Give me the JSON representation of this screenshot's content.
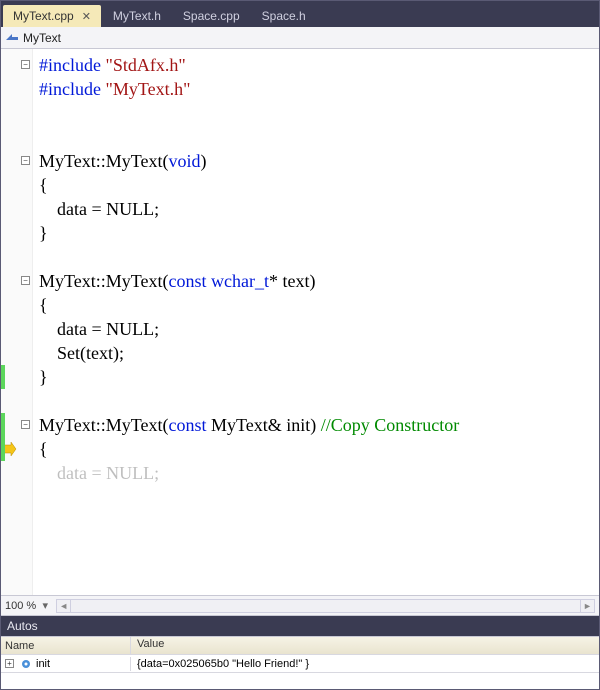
{
  "tabs": [
    {
      "label": "MyText.cpp",
      "active": true
    },
    {
      "label": "MyText.h",
      "active": false
    },
    {
      "label": "Space.cpp",
      "active": false
    },
    {
      "label": "Space.h",
      "active": false
    }
  ],
  "nav": {
    "scope": "MyText"
  },
  "zoom": {
    "level": "100 %"
  },
  "code": {
    "lines": [
      {
        "t": [
          {
            "c": "kw",
            "s": "#include "
          },
          {
            "c": "str",
            "s": "\"StdAfx.h\""
          }
        ],
        "fold": "minus"
      },
      {
        "t": [
          {
            "c": "kw",
            "s": "#include "
          },
          {
            "c": "str",
            "s": "\"MyText.h\""
          }
        ]
      },
      {
        "t": []
      },
      {
        "t": []
      },
      {
        "t": [
          {
            "s": "MyText::MyText("
          },
          {
            "c": "kw",
            "s": "void"
          },
          {
            "s": ")"
          }
        ],
        "fold": "minus"
      },
      {
        "t": [
          {
            "s": "{"
          }
        ]
      },
      {
        "t": [
          {
            "s": "    data = NULL;"
          }
        ]
      },
      {
        "t": [
          {
            "s": "}"
          }
        ]
      },
      {
        "t": []
      },
      {
        "t": [
          {
            "s": "MyText::MyText("
          },
          {
            "c": "kw",
            "s": "const"
          },
          {
            "s": " "
          },
          {
            "c": "kw",
            "s": "wchar_t"
          },
          {
            "s": "* text)"
          }
        ],
        "fold": "minus"
      },
      {
        "t": [
          {
            "s": "{"
          }
        ]
      },
      {
        "t": [
          {
            "s": "    data = NULL;"
          }
        ]
      },
      {
        "t": [
          {
            "s": "    Set(text);"
          }
        ]
      },
      {
        "t": [
          {
            "s": "}"
          }
        ],
        "changed": true
      },
      {
        "t": []
      },
      {
        "t": [
          {
            "s": "MyText::MyText("
          },
          {
            "c": "kw",
            "s": "const"
          },
          {
            "s": " MyText& init) "
          },
          {
            "c": "cmt",
            "s": "//Copy Constructor"
          }
        ],
        "fold": "minus",
        "changed": true
      },
      {
        "t": [
          {
            "s": "{"
          }
        ],
        "exec": true,
        "changed": true
      },
      {
        "t": [
          {
            "s": "    data = NULL;"
          }
        ],
        "dim": true
      }
    ],
    "line_height": 24,
    "top_pad": 4
  },
  "panel": {
    "title": "Autos",
    "columns": {
      "name": "Name",
      "value": "Value"
    },
    "rows": [
      {
        "name": "init",
        "value": "{data=0x025065b0 \"Hello Friend!\" }"
      }
    ]
  }
}
